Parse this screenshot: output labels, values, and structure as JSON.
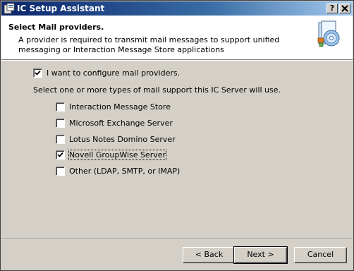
{
  "window": {
    "title": "IC Setup Assistant"
  },
  "titlebar": {
    "help_label": "?",
    "close_label": "X"
  },
  "header": {
    "title": "Select Mail providers.",
    "description": "A provider is required to transmit mail messages to support unified messaging or Interaction Message Store applications"
  },
  "main": {
    "configure_checkbox": {
      "label": "I want to configure mail providers.",
      "checked": true
    },
    "instruction": "Select one or more types of mail support this IC Server will use.",
    "providers": [
      {
        "label": "Interaction Message Store",
        "checked": false
      },
      {
        "label": "Microsoft Exchange Server",
        "checked": false
      },
      {
        "label": "Lotus Notes Domino Server",
        "checked": false
      },
      {
        "label": "Novell GroupWise Server",
        "checked": true
      },
      {
        "label": "Other (LDAP, SMTP, or IMAP)",
        "checked": false
      }
    ]
  },
  "buttons": {
    "back": "< Back",
    "next": "Next >",
    "cancel": "Cancel"
  },
  "colors": {
    "titlebar_start": "#0a246a",
    "titlebar_end": "#a6caf0",
    "dialog_bg": "#d4d0c8",
    "header_bg": "#ffffff"
  }
}
